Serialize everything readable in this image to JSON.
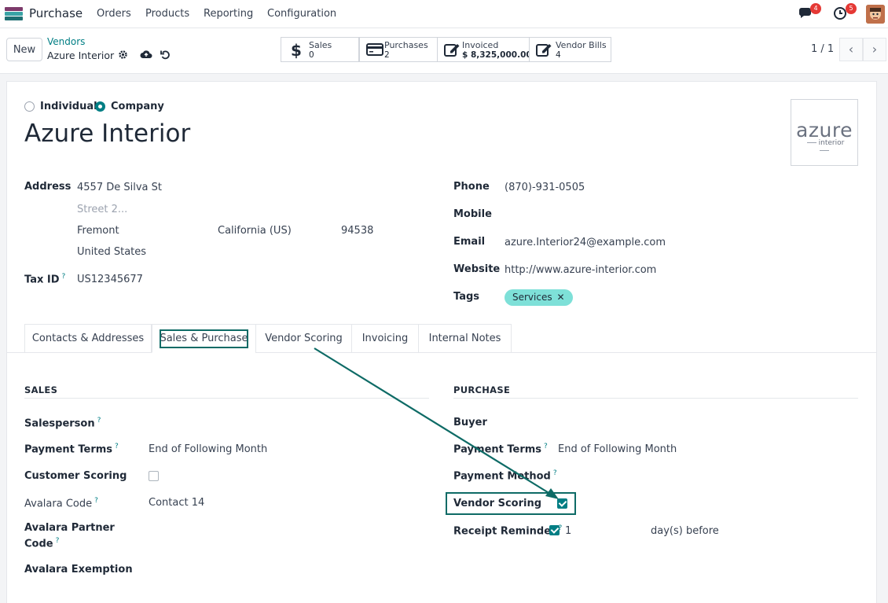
{
  "navbar": {
    "app_name": "Purchase",
    "menu": [
      "Orders",
      "Products",
      "Reporting",
      "Configuration"
    ],
    "messages_count": "4",
    "activities_count": "5",
    "app_colors": [
      "#7c3a6b",
      "#3aa3a6",
      "#1f6f73"
    ]
  },
  "control": {
    "new_label": "New",
    "breadcrumb_parent": "Vendors",
    "breadcrumb_current": "Azure Interior",
    "smart_buttons": [
      {
        "title": "Sales",
        "value": "0",
        "icon": "dollar-icon"
      },
      {
        "title": "Purchases",
        "value": "2",
        "icon": "credit-card-icon"
      },
      {
        "title": "Invoiced",
        "value": "$ 8,325,000.00",
        "icon": "edit-icon"
      },
      {
        "title": "Vendor Bills",
        "value": "4",
        "icon": "edit-icon"
      }
    ],
    "pager": "1 / 1"
  },
  "form": {
    "company_type": {
      "individual": "Individual",
      "company": "Company",
      "selected": "Company"
    },
    "name": "Azure Interior",
    "logo": {
      "main": "azure",
      "sub": "interior"
    },
    "address_label": "Address",
    "street": "4557 De Silva St",
    "street2_placeholder": "Street 2...",
    "city": "Fremont",
    "state": "California (US)",
    "zip": "94538",
    "country": "United States",
    "tax_id_label": "Tax ID",
    "tax_id": "US12345677",
    "phone_label": "Phone",
    "phone": "(870)-931-0505",
    "mobile_label": "Mobile",
    "email_label": "Email",
    "email": "azure.Interior24@example.com",
    "website_label": "Website",
    "website": "http://www.azure-interior.com",
    "tags_label": "Tags",
    "tag": "Services"
  },
  "tabs": [
    {
      "label": "Contacts & Addresses"
    },
    {
      "label": "Sales & Purchase"
    },
    {
      "label": "Vendor Scoring"
    },
    {
      "label": "Invoicing"
    },
    {
      "label": "Internal Notes"
    }
  ],
  "sales": {
    "heading": "SALES",
    "salesperson_label": "Salesperson",
    "payment_terms_label": "Payment Terms",
    "payment_terms": "End of Following Month",
    "customer_scoring_label": "Customer Scoring",
    "customer_scoring": false,
    "avalara_code_label": "Avalara Code",
    "avalara_code": "Contact 14",
    "avalara_partner_label_1": "Avalara Partner",
    "avalara_partner_label_2": "Code",
    "avalara_exemption_label": "Avalara Exemption"
  },
  "purchase": {
    "heading": "PURCHASE",
    "buyer_label": "Buyer",
    "payment_terms_label": "Payment Terms",
    "payment_terms": "End of Following Month",
    "payment_method_label": "Payment Method",
    "vendor_scoring_label": "Vendor Scoring",
    "vendor_scoring": true,
    "receipt_reminder_label": "Receipt Reminder",
    "receipt_reminder": true,
    "reminder_days": "1",
    "reminder_suffix": "day(s) before"
  },
  "colors": {
    "accent": "#017e84",
    "highlight": "#0e6b66",
    "tag": "#7ee0d8"
  }
}
